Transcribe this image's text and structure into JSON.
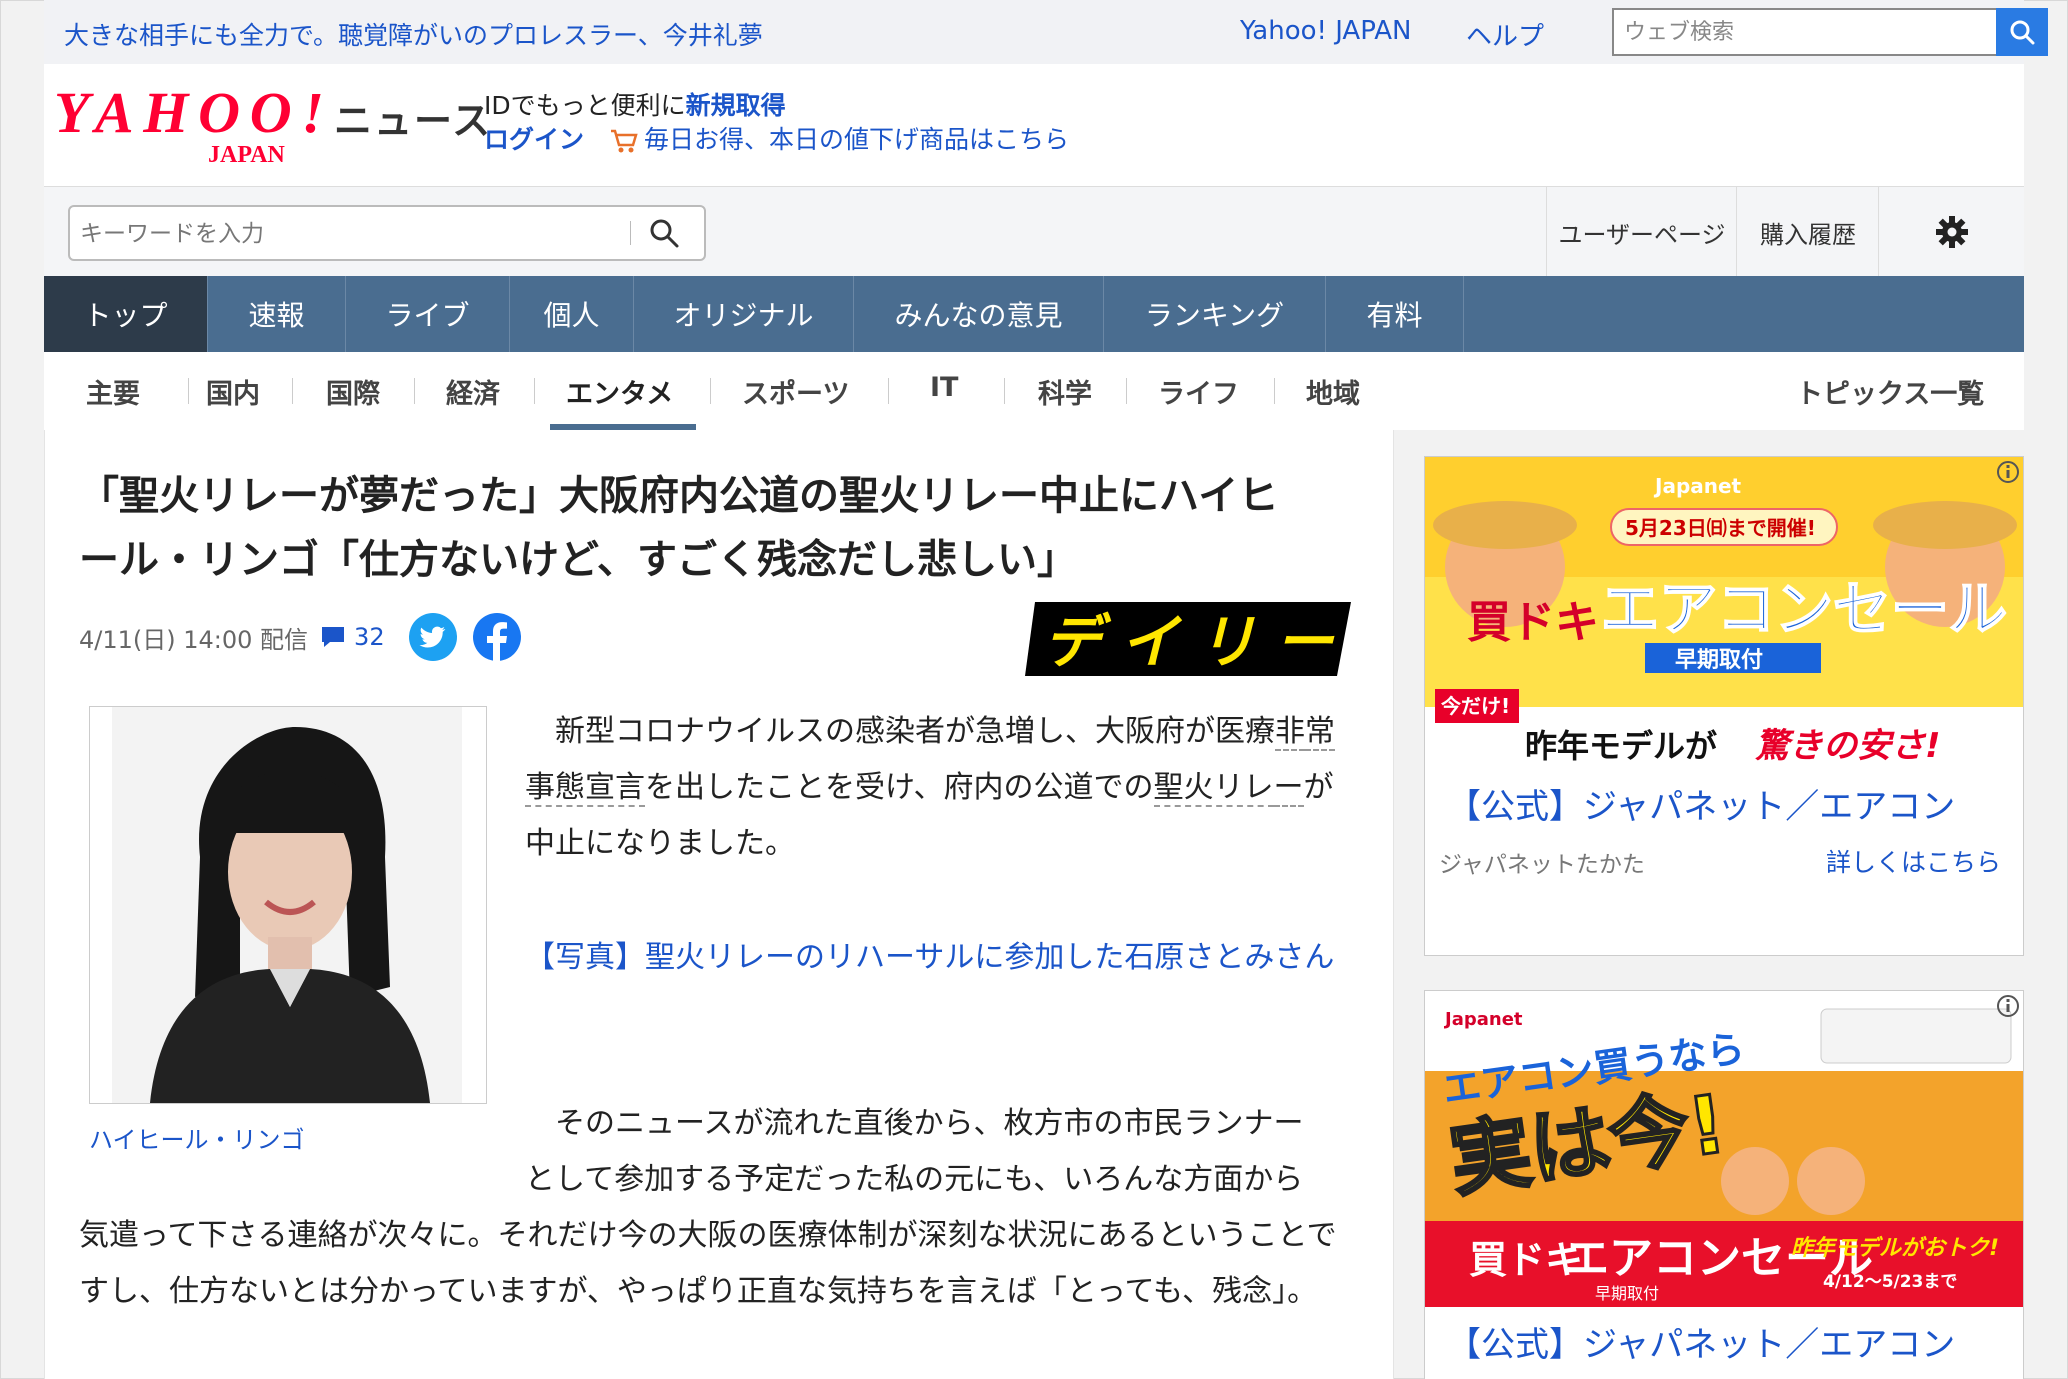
{
  "topbar": {
    "promo_text": "大きな相手にも全力で。聴覚障がいのプロレスラー、今井礼夢",
    "yahoo_japan_link": "Yahoo! JAPAN",
    "help_link": "ヘルプ",
    "web_search_placeholder": "ウェブ検索"
  },
  "header": {
    "logo_text": "YAHOO!",
    "logo_sub": "JAPAN",
    "news_label": "ニュース",
    "id_line": "IDでもっと便利に",
    "signup_link": "新規取得",
    "login_link": "ログイン",
    "deal_link": "毎日お得、本日の値下げ商品はこちら"
  },
  "search": {
    "keyword_placeholder": "キーワードを入力",
    "user_page": "ユーザーページ",
    "purchase_history": "購入履歴"
  },
  "nav": {
    "items": [
      {
        "label": "トップ",
        "active": true
      },
      {
        "label": "速報"
      },
      {
        "label": "ライブ"
      },
      {
        "label": "個人"
      },
      {
        "label": "オリジナル"
      },
      {
        "label": "みんなの意見"
      },
      {
        "label": "ランキング"
      },
      {
        "label": "有料"
      }
    ]
  },
  "subnav": {
    "items": [
      "主要",
      "国内",
      "国際",
      "経済",
      "エンタメ",
      "スポーツ",
      "IT",
      "科学",
      "ライフ",
      "地域"
    ],
    "active": "エンタメ",
    "topics_link": "トピックス一覧"
  },
  "article": {
    "title_line1": "「聖火リレーが夢だった」大阪府内公道の聖火リレー中止にハイヒ",
    "title_line2": "ール・リンゴ「仕方ないけど、すごく残念だし悲しい」",
    "date": "4/11(日) 14:00 配信",
    "comment_count": "32",
    "source_logo": "デイリー",
    "photo_caption": "ハイヒール・リンゴ",
    "para1_a": "新型コロナウイルスの感染者が急増し、大阪府が医療",
    "para1_b": "非",
    "para1_c": "常事態宣言",
    "para1_d": "を出したことを受け、府内の公道での",
    "para1_e": "聖火リレ",
    "para1_f": "ー",
    "para1_g": "が中止になりました。",
    "photo_link": "【写真】聖火リレーのリハーサルに参加した石原さとみさん",
    "para2_line1": "そのニュースが流れた直後から、枚方市の市民ランナー",
    "para2_line2": "として参加する予定だった私の元にも、いろんな方面から",
    "para2_rest": "気遣って下さる連絡が次々に。それだけ今の大阪の医療体制が深刻な状況にあるということですし、仕方ないとは分かっていますが、やっぱり正直な気持ちを言えば「とっても、残念」。"
  },
  "ads": [
    {
      "brand": "Japanet",
      "badge": "5月23日㈰まで開催!",
      "banner_main": "エアコンセール",
      "banner_pre": "買ドキ",
      "banner_sub": "早期取付",
      "banner_tag": "今だけ!",
      "banner_bottom_a": "昨年モデルが",
      "banner_bottom_b": "驚きの安さ!",
      "title": "【公式】ジャパネット／エアコン",
      "sponsor": "ジャパネットたかた",
      "more": "詳しくはこちら"
    },
    {
      "brand": "Japanet",
      "banner_line1": "エアコン買うなら",
      "banner_line2": "実は今!",
      "banner_pre": "買ドキ",
      "banner_main": "エアコンセール",
      "banner_sub": "早期取付",
      "banner_right": "昨年モデルがおトク!",
      "banner_dates": "4/12～5/23まで",
      "title": "【公式】ジャパネット／エアコン"
    }
  ],
  "colors": {
    "link_blue": "#1b55c9",
    "nav_bg": "#4a6d90",
    "nav_active": "#2d3b4a",
    "logo_red": "#ff0033"
  }
}
